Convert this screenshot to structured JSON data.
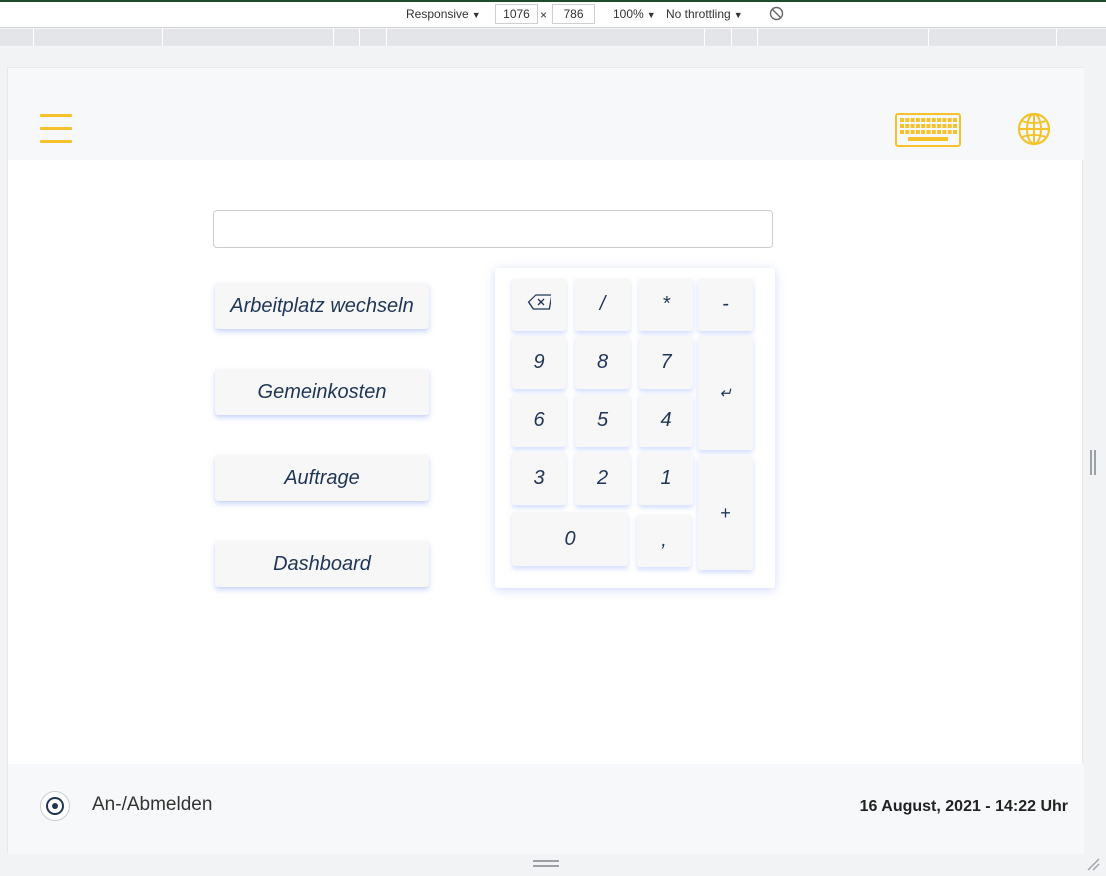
{
  "devtools": {
    "device": "Responsive",
    "width": "1076",
    "times": "×",
    "height": "786",
    "zoom": "100%",
    "throttling": "No throttling",
    "caret": "▼"
  },
  "app": {
    "search_value": "",
    "nav_buttons": [
      "Arbeitplatz wechseln",
      "Gemeinkosten",
      "Auftrage",
      "Dashboard"
    ],
    "keypad": {
      "backspace": "⌫",
      "divide": "/",
      "multiply": "*",
      "minus": "-",
      "k9": "9",
      "k8": "8",
      "k7": "7",
      "k6": "6",
      "k5": "5",
      "k4": "4",
      "k3": "3",
      "k2": "2",
      "k1": "1",
      "k0": "0",
      "comma": ",",
      "enter": "↵",
      "plus": "+"
    },
    "footer": {
      "radio_label": "An-/Abmelden",
      "datetime": "16 August, 2021 - 14:22 Uhr"
    }
  },
  "colors": {
    "accent": "#f6c22b",
    "text_dark": "#1f3556",
    "keypad_shadow": "#7896ff"
  },
  "icons": [
    "hamburger-icon",
    "keyboard-icon",
    "globe-icon",
    "backspace-icon",
    "rotate-disabled-icon"
  ]
}
